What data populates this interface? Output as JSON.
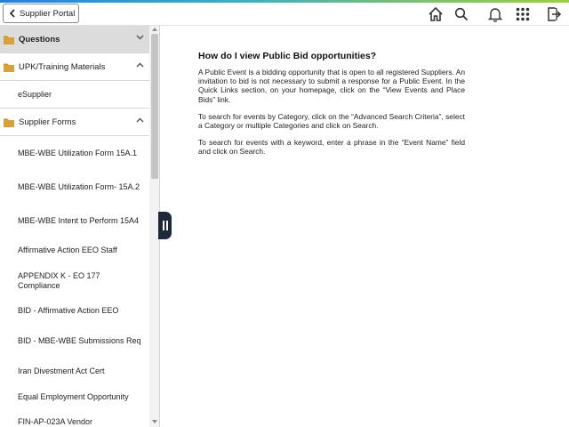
{
  "header": {
    "back_label": "Supplier Portal",
    "icons": [
      "home-icon",
      "search-icon",
      "notification-bell-icon",
      "navbar-grid-icon",
      "sign-out-icon"
    ]
  },
  "sidebar": {
    "sections": [
      {
        "label": "Questions",
        "state": "collapsed",
        "selected": true
      },
      {
        "label": "UPK/Training Materials",
        "state": "expanded",
        "selected": false
      },
      {
        "label": "Supplier Forms",
        "state": "expanded",
        "selected": false
      }
    ],
    "upk_items": [
      "eSupplier"
    ],
    "form_items": [
      "MBE-WBE Utilization Form 15A.1",
      "MBE-WBE Utilization Form- 15A.2",
      "MBE-WBE Intent to Perform 15A4",
      "Affirmative Action EEO Staff",
      "APPENDIX K - EO 177 Compliance",
      "BID - Affirmative Action EEO",
      "BID - MBE-WBE Submissions Req",
      "Iran Divestment Act Cert",
      "Equal Employment Opportunity",
      "FIN-AP-023A Vendor"
    ]
  },
  "content": {
    "title": "How do I view Public Bid opportunities?",
    "paragraphs": [
      "A Public Event is a bidding opportunity that is open to all registered Suppliers. An invitation to bid is not necessary to submit a response for a Public Event. In the Quick Links section, on your homepage, click on the “View Events and Place Bids” link.",
      "To search for events by Category, click on the “Advanced Search Criteria”, select a Category or multiple Categories and click on Search.",
      "To search for events with a keyword, enter a phrase in the “Event Name” field and click on Search."
    ]
  },
  "colors": {
    "folder": "#c8922a",
    "selected_bg": "#dcdcdc",
    "splitter": "#1e2a3a",
    "icon": "#333333"
  }
}
